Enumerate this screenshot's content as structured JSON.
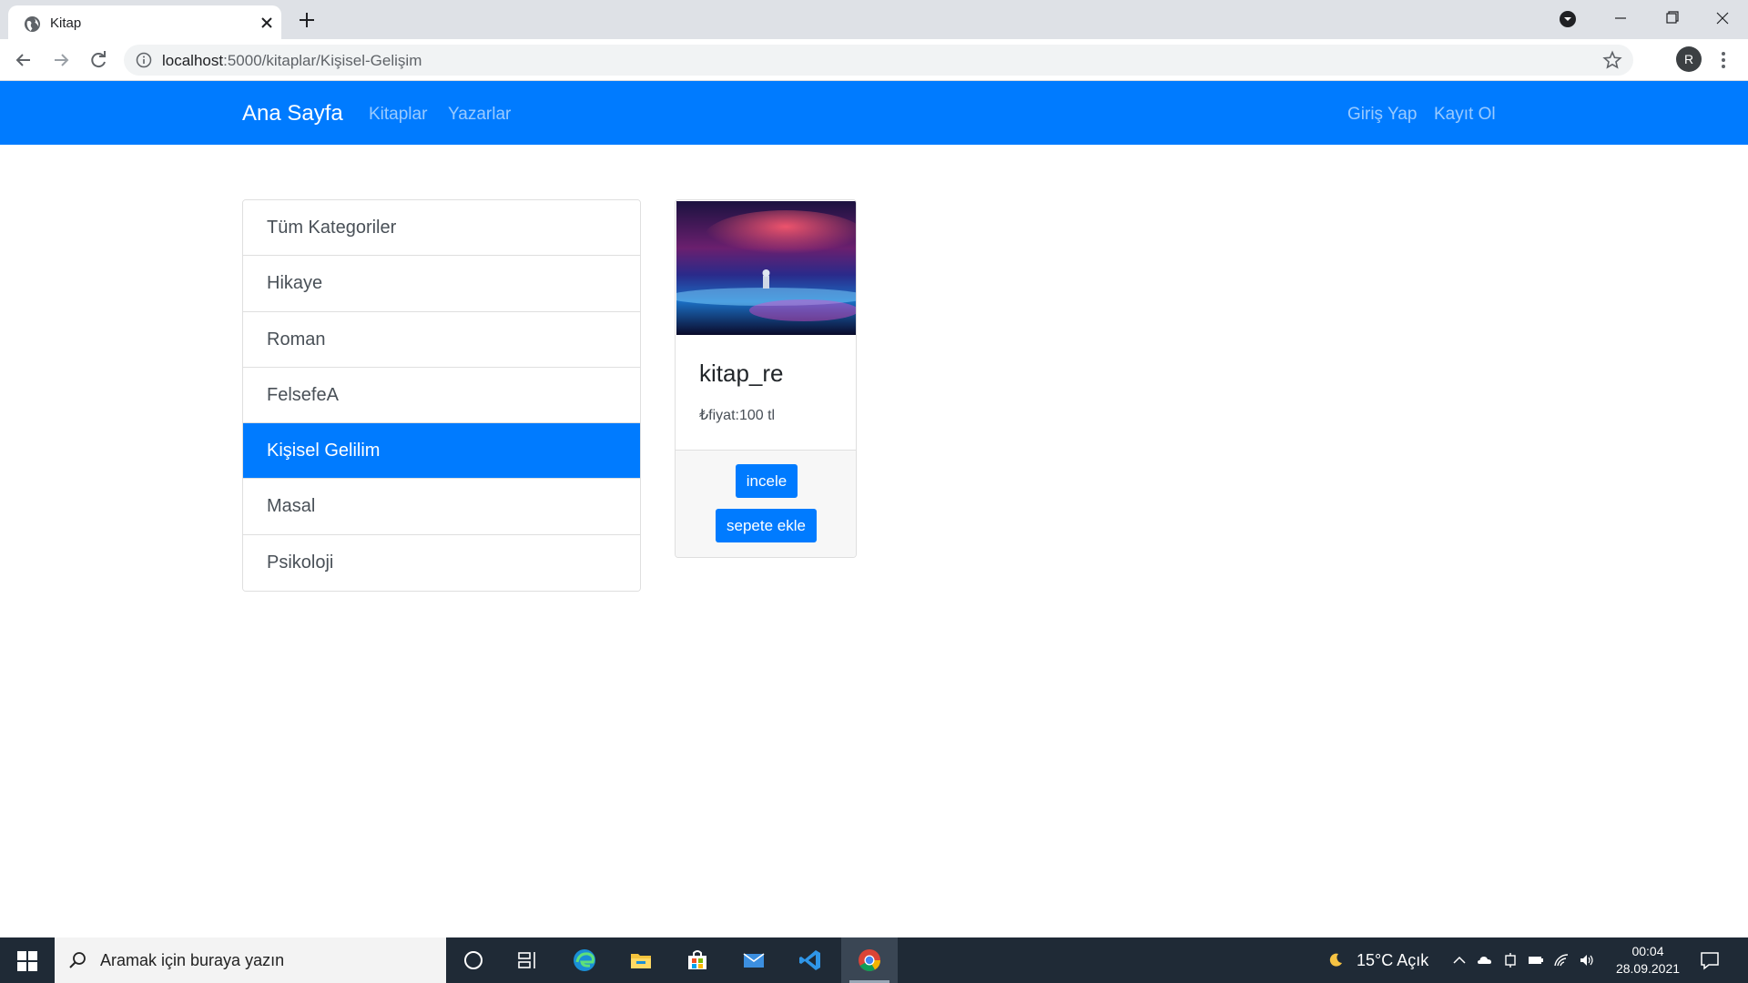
{
  "browser": {
    "tab_title": "Kitap",
    "url_host": "localhost",
    "url_path": ":5000/kitaplar/Kişisel-Gelişim",
    "profile_initial": "R"
  },
  "navbar": {
    "brand": "Ana Sayfa",
    "links": [
      "Kitaplar",
      "Yazarlar"
    ],
    "auth": [
      "Giriş Yap",
      "Kayıt Ol"
    ],
    "color": "#007bff"
  },
  "categories": {
    "items": [
      "Tüm Kategoriler",
      "Hikaye",
      "Roman",
      "FelsefeA",
      "Kişisel Gelilim",
      "Masal",
      "Psikoloji"
    ],
    "active_index": 4
  },
  "product": {
    "title": "kitap_re",
    "price": "₺fiyat:100 tl",
    "view_label": "incele",
    "cart_label": "sepete ekle"
  },
  "taskbar": {
    "search_placeholder": "Aramak için buraya yazın",
    "weather": "15°C  Açık",
    "time": "00:04",
    "date": "28.09.2021"
  }
}
